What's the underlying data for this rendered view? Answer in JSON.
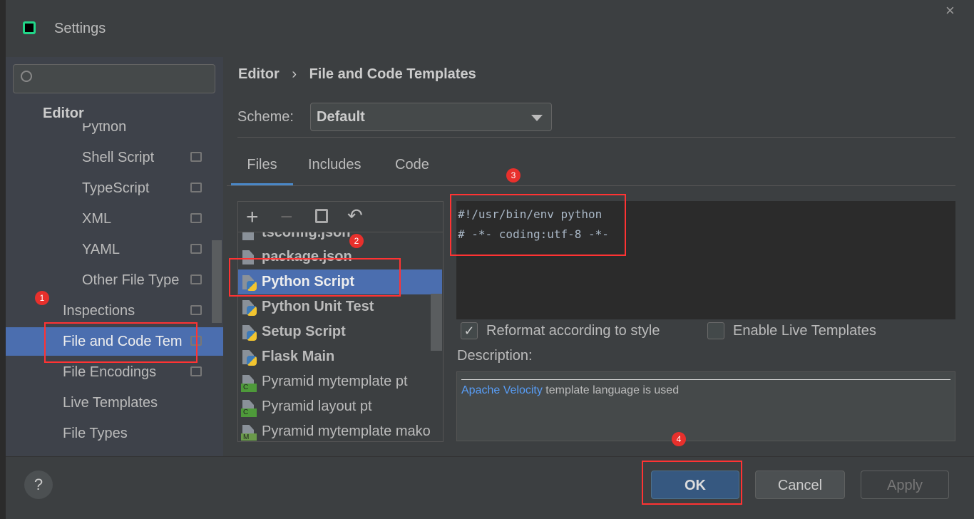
{
  "window": {
    "title": "Settings",
    "close_label": "×"
  },
  "search": {
    "placeholder": ""
  },
  "sidebar": {
    "section": "Editor",
    "items": [
      {
        "label": "Python"
      },
      {
        "label": "Shell Script"
      },
      {
        "label": "TypeScript"
      },
      {
        "label": "XML"
      },
      {
        "label": "YAML"
      },
      {
        "label": "Other File Type"
      },
      {
        "label": "Inspections"
      },
      {
        "label": "File and Code Tem"
      },
      {
        "label": "File Encodings"
      },
      {
        "label": "Live Templates"
      },
      {
        "label": "File Types"
      }
    ]
  },
  "breadcrumb": {
    "parent": "Editor",
    "sep": "›",
    "current": "File and Code Templates"
  },
  "scheme": {
    "label": "Scheme:",
    "value": "Default"
  },
  "tabs": [
    {
      "label": "Files"
    },
    {
      "label": "Includes"
    },
    {
      "label": "Code"
    }
  ],
  "templates": [
    {
      "label": "tsconfig.json",
      "bold": true,
      "icon": "json"
    },
    {
      "label": "package.json",
      "bold": true,
      "icon": "json"
    },
    {
      "label": "Python Script",
      "bold": true,
      "icon": "python"
    },
    {
      "label": "Python Unit Test",
      "bold": true,
      "icon": "python"
    },
    {
      "label": "Setup Script",
      "bold": true,
      "icon": "python"
    },
    {
      "label": "Flask Main",
      "bold": true,
      "icon": "python"
    },
    {
      "label": "Pyramid mytemplate pt",
      "bold": false,
      "icon": "C"
    },
    {
      "label": "Pyramid layout pt",
      "bold": false,
      "icon": "C"
    },
    {
      "label": "Pyramid mytemplate mako",
      "bold": false,
      "icon": "M"
    }
  ],
  "editor": {
    "lines": [
      "#!/usr/bin/env python",
      "# -*- coding:utf-8 -*-"
    ]
  },
  "options": {
    "reformat": {
      "label": "Reformat according to style",
      "checked": true
    },
    "live": {
      "label": "Enable Live Templates",
      "checked": false
    }
  },
  "description": {
    "label": "Description:",
    "link": "Apache Velocity",
    "text": " template language is used"
  },
  "buttons": {
    "help": "?",
    "ok": "OK",
    "cancel": "Cancel",
    "apply": "Apply"
  },
  "badges": [
    "1",
    "2",
    "3",
    "4"
  ],
  "colors": {
    "selection": "#4b6eaf",
    "annotation": "#ff3333",
    "link": "#589df6"
  }
}
